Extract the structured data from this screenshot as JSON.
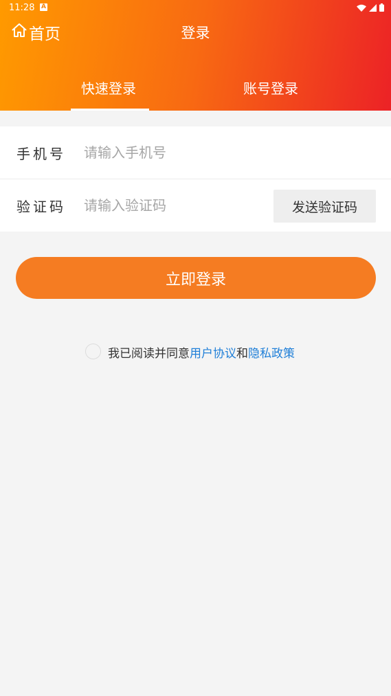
{
  "status_bar": {
    "time": "11:28",
    "notification_icon_letter": "A"
  },
  "header": {
    "home_label": "首页",
    "title": "登录"
  },
  "tabs": [
    {
      "label": "快速登录",
      "active": true
    },
    {
      "label": "账号登录",
      "active": false
    }
  ],
  "form": {
    "phone": {
      "label": "手机号",
      "placeholder": "请输入手机号",
      "value": ""
    },
    "code": {
      "label": "验证码",
      "placeholder": "请输入验证码",
      "value": "",
      "send_button_label": "发送验证码"
    }
  },
  "login_button_label": "立即登录",
  "agreement": {
    "prefix": "我已阅读并同意",
    "user_agreement": "用户协议",
    "conjunction": "和",
    "privacy_policy": "隐私政策",
    "checked": false
  },
  "colors": {
    "header_gradient_start": "#ff9a00",
    "header_gradient_end": "#ec2226",
    "primary_button": "#f57c22",
    "link": "#1f7fd8",
    "background": "#f4f4f4"
  }
}
